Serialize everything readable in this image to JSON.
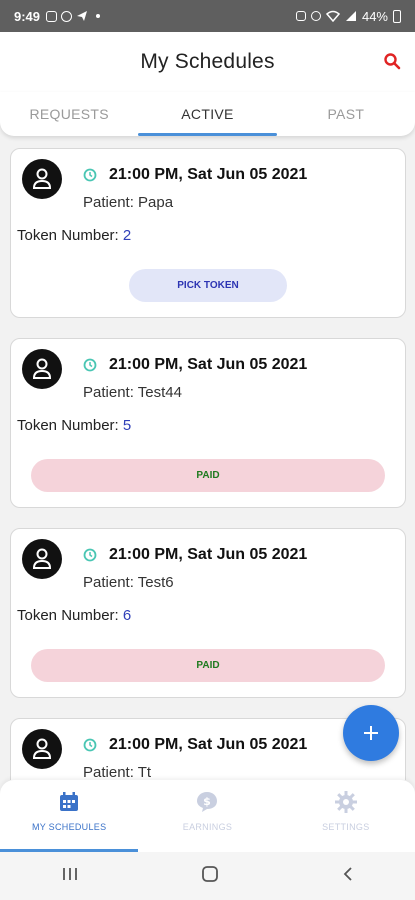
{
  "status_bar": {
    "time": "9:49",
    "battery": "44%"
  },
  "header": {
    "title": "My Schedules"
  },
  "tabs": [
    {
      "label": "REQUESTS"
    },
    {
      "label": "ACTIVE"
    },
    {
      "label": "PAST"
    }
  ],
  "schedules": [
    {
      "datetime": "21:00 PM, Sat Jun 05 2021",
      "patient": "Patient: Papa",
      "token_label": "Token Number: ",
      "token_number": "2",
      "action": "PICK TOKEN"
    },
    {
      "datetime": "21:00 PM, Sat Jun 05 2021",
      "patient": "Patient: Test44",
      "token_label": "Token Number: ",
      "token_number": "5",
      "status": "PAID"
    },
    {
      "datetime": "21:00 PM, Sat Jun 05 2021",
      "patient": "Patient: Test6",
      "token_label": "Token Number: ",
      "token_number": "6",
      "status": "PAID"
    },
    {
      "datetime": "21:00 PM, Sat Jun 05 2021",
      "patient": "Patient: Tt"
    }
  ],
  "bottom_nav": [
    {
      "label": "MY SCHEDULES",
      "icon": "calendar-icon"
    },
    {
      "label": "EARNINGS",
      "icon": "dollar-icon"
    },
    {
      "label": "SETTINGS",
      "icon": "gear-icon"
    }
  ],
  "colors": {
    "accent": "#2f7be0",
    "tab_underline": "#4a90d9",
    "paid_bg": "#f5d3da",
    "paid_text": "#1f7a1f",
    "pick_bg": "#e2e6f8",
    "pick_text": "#2d35b3",
    "token_num": "#2f3fb8",
    "clock": "#49c6b3",
    "search": "#e02424"
  }
}
